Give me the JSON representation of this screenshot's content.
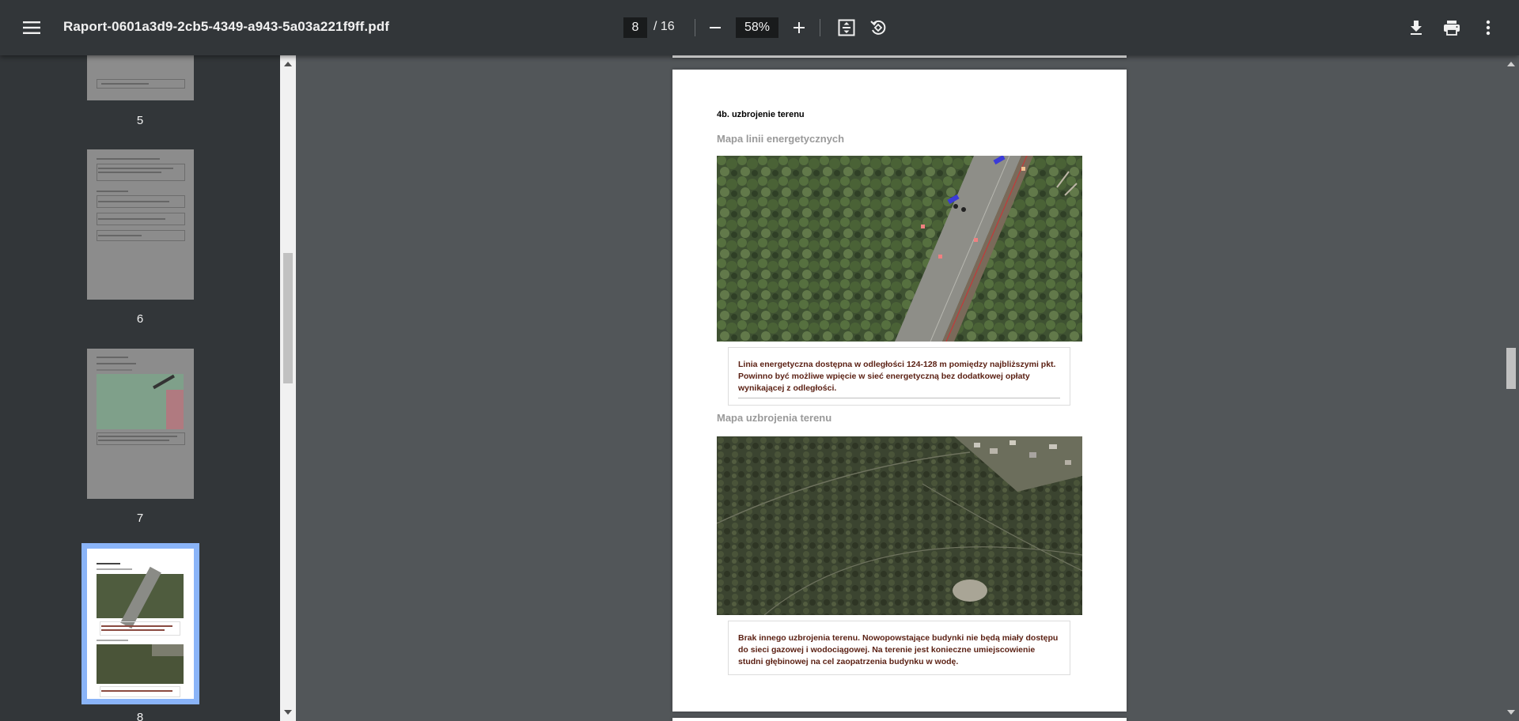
{
  "toolbar": {
    "menu_icon": "menu-icon",
    "filename": "Raport-0601a3d9-2cb5-4349-a943-5a03a221f9ff.pdf",
    "current_page": "8",
    "page_total": "/ 16",
    "zoom": "58%",
    "zoom_out_icon": "minus-icon",
    "zoom_in_icon": "plus-icon",
    "fit_icon": "fit-page-icon",
    "rotate_icon": "rotate-icon",
    "download_icon": "download-icon",
    "print_icon": "print-icon",
    "more_icon": "more-vert-icon"
  },
  "sidebar": {
    "thumbnails": [
      {
        "label": "5"
      },
      {
        "label": "6"
      },
      {
        "label": "7"
      },
      {
        "label": "8",
        "active": true
      }
    ]
  },
  "page": {
    "section_heading": "4b. uzbrojenie terenu",
    "energy": {
      "heading": "Mapa linii energetycznych",
      "note": "Linia energetyczna dostępna w odległości 124-128 m pomiędzy najbliższymi pkt. Powinno być możliwe wpięcie w sieć energetyczną bez dodatkowej opłaty wynikającej z odległości."
    },
    "utilities": {
      "heading": "Mapa uzbrojenia terenu",
      "note": "Brak innego uzbrojenia terenu. Nowopowstające budynki nie będą miały dostępu do sieci gazowej i wodociągowej. Na terenie jest konieczne umiejscowienie studni głębinowej na cel zaopatrzenia budynku w wodę."
    }
  },
  "colors": {
    "toolbar_bg": "#323639",
    "viewer_bg": "#525659",
    "active_thumb_outline": "#8ab4f8",
    "note_text": "#5a1f12"
  }
}
